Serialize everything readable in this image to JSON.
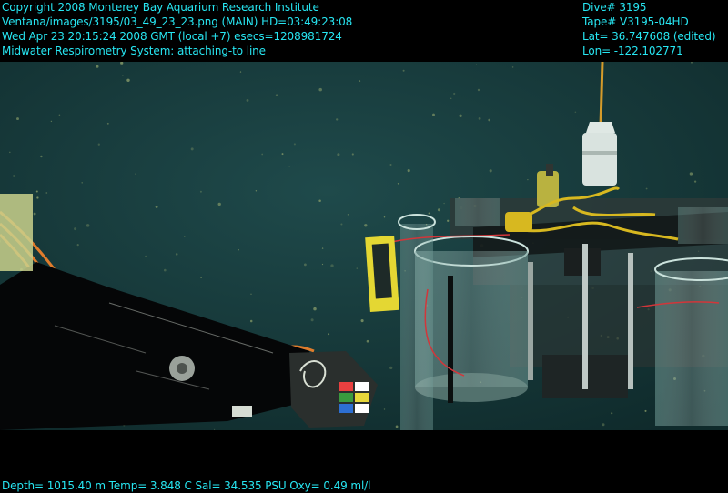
{
  "header_left": [
    "Copyright 2008 Monterey Bay Aquarium Research Institute",
    "Ventana/images/3195/03_49_23_23.png (MAIN)  HD=03:49:23:08",
    "Wed Apr 23 20:15:24 2008 GMT (local +7)  esecs=1208981724",
    "Midwater Respirometry System: attaching-to line"
  ],
  "header_right": [
    "Dive# 3195",
    "Tape# V3195-04HD",
    "Lat= 36.747608 (edited)",
    "Lon= -122.102771"
  ],
  "footer": "Depth= 1015.40 m  Temp= 3.848 C  Sal= 34.535 PSU  Oxy= 0.49 ml/l",
  "colors": {
    "overlay_text": "#27e6f2",
    "water": "#183a3b",
    "frame": "#000000"
  }
}
